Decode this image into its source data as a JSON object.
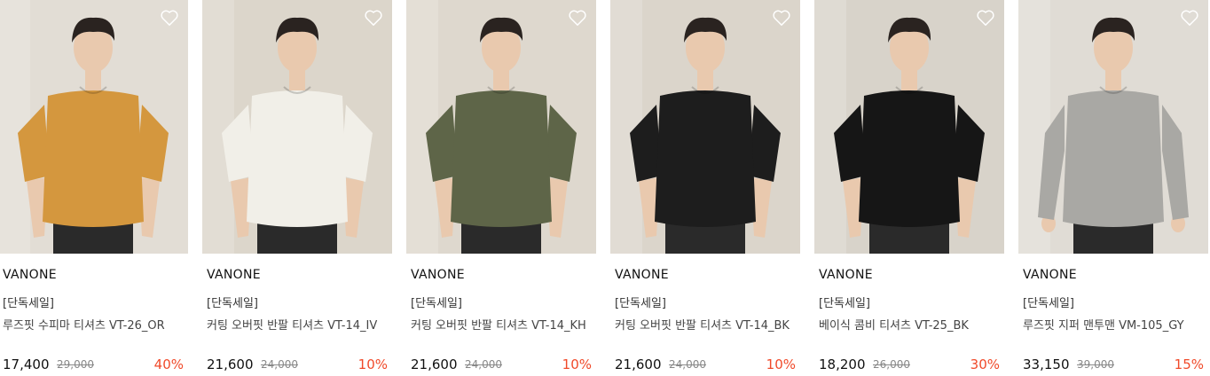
{
  "products": [
    {
      "brand": "VANONE",
      "tag": "[단독세일]",
      "name": "루즈핏 수피마 티셔츠 VT-26_OR",
      "price": "17,400",
      "original_price": "29,000",
      "discount": "40%",
      "shirt_color": "#d4973e",
      "bg_color": "#e2ddd5",
      "wishlist_icon": "heart-outline-icon"
    },
    {
      "brand": "VANONE",
      "tag": "[단독세일]",
      "name": "커팅 오버핏 반팔 티셔츠 VT-14_IV",
      "price": "21,600",
      "original_price": "24,000",
      "discount": "10%",
      "shirt_color": "#f1efe8",
      "bg_color": "#dcd6cb",
      "wishlist_icon": "heart-outline-icon"
    },
    {
      "brand": "VANONE",
      "tag": "[단독세일]",
      "name": "커팅 오버핏 반팔 티셔츠 VT-14_KH",
      "price": "21,600",
      "original_price": "24,000",
      "discount": "10%",
      "shirt_color": "#5e6548",
      "bg_color": "#ded8ce",
      "wishlist_icon": "heart-outline-icon"
    },
    {
      "brand": "VANONE",
      "tag": "[단독세일]",
      "name": "커팅 오버핏 반팔 티셔츠 VT-14_BK",
      "price": "21,600",
      "original_price": "24,000",
      "discount": "10%",
      "shirt_color": "#1d1d1d",
      "bg_color": "#dbd5cb",
      "wishlist_icon": "heart-outline-icon"
    },
    {
      "brand": "VANONE",
      "tag": "[단독세일]",
      "name": "베이식 콤비 티셔츠 VT-25_BK",
      "price": "18,200",
      "original_price": "26,000",
      "discount": "30%",
      "shirt_color": "#161616",
      "bg_color": "#d8d3ca",
      "wishlist_icon": "heart-outline-icon"
    },
    {
      "brand": "VANONE",
      "tag": "[단독세일]",
      "name": "루즈핏 지퍼 맨투맨 VM-105_GY",
      "price": "33,150",
      "original_price": "39,000",
      "discount": "15%",
      "shirt_color": "#a9a8a4",
      "bg_color": "#e0dcd5",
      "wishlist_icon": "heart-outline-icon"
    }
  ],
  "colors": {
    "discount": "#f04a2a",
    "skin": "#e9c9ae",
    "hair": "#2a2320",
    "pants": "#2a2a2a"
  }
}
